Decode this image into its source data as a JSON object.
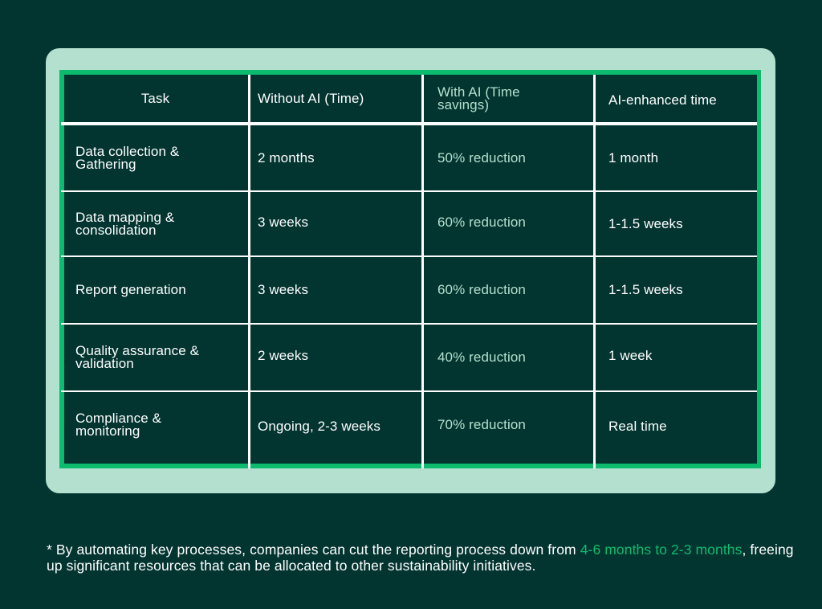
{
  "colors": {
    "background": "#023430",
    "panel": "#b4e0cf",
    "frame_accent": "#0cbb6e",
    "mint_text": "#b4e0cc",
    "text": "#ffffff"
  },
  "table": {
    "headers": [
      "Task",
      "Without AI (Time)",
      "With AI (Time savings)",
      "AI-enhanced time"
    ],
    "rows": [
      {
        "task": "Data collection & Gathering",
        "without_ai": "2 months",
        "with_ai": "50% reduction",
        "ai_enhanced": "1 month"
      },
      {
        "task": "Data mapping & consolidation",
        "without_ai": "3 weeks",
        "with_ai": "60% reduction",
        "ai_enhanced": "1-1.5 weeks"
      },
      {
        "task": "Report generation",
        "without_ai": "3 weeks",
        "with_ai": "60% reduction",
        "ai_enhanced": "1-1.5 weeks"
      },
      {
        "task": "Quality assurance & validation",
        "without_ai": "2 weeks",
        "with_ai": "40% reduction",
        "ai_enhanced": "1 week"
      },
      {
        "task": "Compliance & monitoring",
        "without_ai": "Ongoing, 2-3 weeks",
        "with_ai": "70% reduction",
        "ai_enhanced": "Real time"
      }
    ]
  },
  "footnote": {
    "prefix": "* By automating key processes, companies can cut the reporting process down from ",
    "highlight": "4-6 months to 2-3 months",
    "suffix": ", freeing up significant resources that can be allocated to other sustainability initiatives."
  }
}
